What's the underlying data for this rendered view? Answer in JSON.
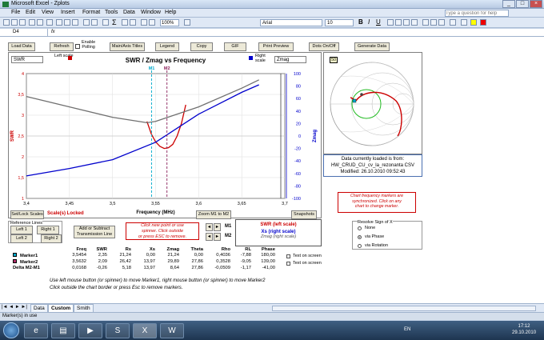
{
  "window": {
    "title": "Microsoft Excel - Zplots",
    "question_placeholder": "Type a question for help"
  },
  "menu": [
    "File",
    "Edit",
    "View",
    "Insert",
    "Format",
    "Tools",
    "Data",
    "Window",
    "Help"
  ],
  "toolbar": {
    "font": "Arial",
    "size": "10",
    "zoom": "100%"
  },
  "formula": {
    "cell": "D4",
    "fx": "fx"
  },
  "buttons": {
    "load": "Load Data",
    "refresh": "Refresh",
    "enable": "Enable",
    "polling": "Polling",
    "main_axis": "Main/Axis Titles",
    "legend": "Legend",
    "copy": "Copy",
    "gif": "GIF",
    "print": "Print Preview",
    "dots": "Dots On/Off",
    "generate": "Generate Data",
    "set_lock": "Set/Lock Scales",
    "zoom": "Zoom M1 to M2",
    "snapshots": "Snapshots",
    "left1": "Left 1",
    "right1": "Right 1",
    "left2": "Left 2",
    "right2": "Right 2",
    "add_sub": "Add or Subtract",
    "tline": "Transmission Line",
    "m1": "M1",
    "m2": "M2"
  },
  "chart": {
    "title": "SWR / Zmag  vs  Frequency",
    "left_select": "SWR",
    "left_scale": "Left scale",
    "right_scale": "Right scale",
    "right_select": "Zmag",
    "scales_locked": "Scale(s) Locked",
    "m1_label": "M1",
    "m2_label": "M2"
  },
  "chart_data": {
    "type": "line",
    "xlabel": "Frequency (MHz)",
    "ylabel": "SWR",
    "y2label": "Zmag",
    "xlim": [
      3.4,
      3.7
    ],
    "ylim": [
      1,
      4
    ],
    "y2lim": [
      -100,
      100
    ],
    "x_ticks": [
      "3,4",
      "3,45",
      "3,5",
      "3,55",
      "3,6",
      "3,65",
      "3,7"
    ],
    "y_ticks": [
      "4",
      "3,5",
      "3",
      "2,5",
      "2",
      "1,5",
      "1"
    ],
    "y2_ticks": [
      "100",
      "80",
      "60",
      "40",
      "20",
      "0",
      "-20",
      "-40",
      "-60",
      "-80",
      "-100"
    ],
    "series": [
      {
        "name": "SWR",
        "axis": "left",
        "color": "#cc0000",
        "x": [
          3.54,
          3.545,
          3.55,
          3.555,
          3.56,
          3.565,
          3.57,
          3.575,
          3.58,
          3.585
        ],
        "y": [
          2.85,
          2.55,
          2.36,
          2.25,
          2.2,
          2.22,
          2.3,
          2.5,
          2.8,
          3.25
        ]
      },
      {
        "name": "Zmag",
        "axis": "right",
        "color": "#0000cc",
        "x": [
          3.4,
          3.45,
          3.5,
          3.55,
          3.6,
          3.65,
          3.67
        ],
        "y": [
          -64,
          -52,
          -38,
          -10,
          35,
          70,
          82
        ]
      },
      {
        "name": "",
        "axis": "left",
        "color": "#707070",
        "x": [
          3.4,
          3.45,
          3.5,
          3.54,
          3.55,
          3.6,
          3.65,
          3.67
        ],
        "y": [
          3.45,
          3.2,
          2.95,
          2.82,
          2.85,
          3.2,
          3.65,
          3.85
        ]
      }
    ],
    "markers": {
      "m1": 3.5454,
      "m2": 3.5632
    }
  },
  "smith": {
    "badge": "50"
  },
  "info": {
    "line1": "Data currently loaded is from:",
    "line2": "HW_CRUD_CU_cv_la_rezonanta CSV",
    "line3": "Modified: 26.10.2010 09:52:43"
  },
  "note": {
    "text1": "Chart frequency markers are",
    "text2": "synchronized.  Click on any",
    "text3": "chart to change marker."
  },
  "click_note": {
    "l1": "Click new point or use",
    "l2": "spinner.  Click outside",
    "l3": "or press ESC to remove."
  },
  "legendbox": {
    "swr": "SWR  (left scale)",
    "xs": "Xs  (right scale)",
    "zmag": "Zmag  (right scale)"
  },
  "resolve": {
    "title": "Resolve Sign of X",
    "none": "None",
    "phase": "via Phase",
    "rotation": "via Rotation"
  },
  "table": {
    "headers": [
      "Freq",
      "SWR",
      "Rs",
      "Xs",
      "Zmag",
      "Theta",
      "Rho",
      "RL",
      "Phase"
    ],
    "rows": [
      {
        "label": "Marker1",
        "vals": [
          "3,5454",
          "2,35",
          "21,24",
          "0,00",
          "21,24",
          "0,00",
          "0,4036",
          "-7,88",
          "180,00"
        ],
        "text": "Text on screen"
      },
      {
        "label": "Marker2",
        "vals": [
          "3,5632",
          "2,09",
          "26,42",
          "13,97",
          "29,89",
          "27,86",
          "0,3528",
          "-9,05",
          "139,00"
        ],
        "text": "Text on screen"
      },
      {
        "label": "Delta M2-M1",
        "vals": [
          "0,0168",
          "-0,26",
          "5,18",
          "13,97",
          "8,64",
          "27,86",
          "-0,0509",
          "-1,17",
          "-41,00"
        ],
        "text": ""
      }
    ]
  },
  "help1": "Use left mouse button (or spinner) to move Marker1, right mouse button (or spinner) to move Marker2",
  "help2": "Click outside the chart border or press Esc to remove markers.",
  "tabs": [
    "Data",
    "Custom",
    "Smith"
  ],
  "status": "Marker(s) in use",
  "clock": {
    "time": "17:12",
    "date": "29.10.2010",
    "lang": "EN"
  }
}
